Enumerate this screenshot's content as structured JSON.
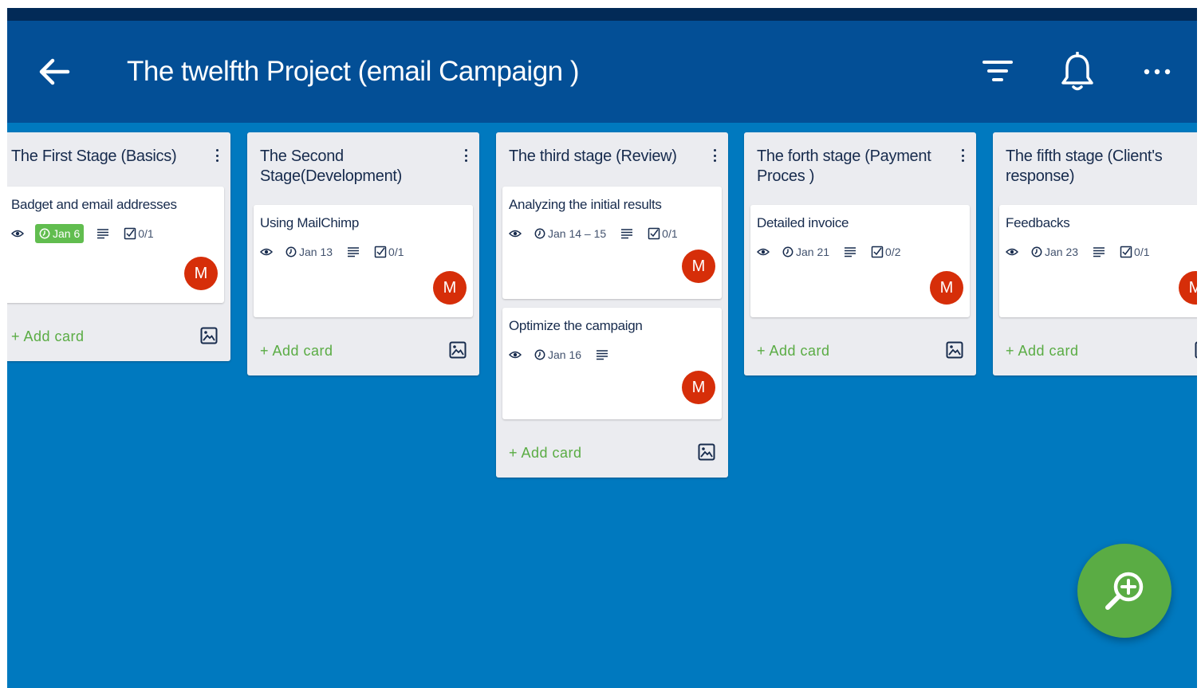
{
  "header": {
    "title": "The twelfth Project (email Campaign )",
    "icons": [
      "back-arrow-icon",
      "filter-icon",
      "bell-icon",
      "more-horizontal-icon"
    ]
  },
  "colors": {
    "statusbar": "#022a57",
    "topbar": "#034f96",
    "board": "#0079bf",
    "list": "#ebecf0",
    "add_card": "#5aac44",
    "avatar": "#d62e09",
    "due_done": "#61bd4f",
    "fab": "#5aac44"
  },
  "lists": [
    {
      "title": "The First Stage (Basics)",
      "add_label": "+ Add card",
      "cards": [
        {
          "title": "Badget and email addresses",
          "due": "Jan 6",
          "due_complete": true,
          "checklist": "0/1",
          "member": "M"
        }
      ]
    },
    {
      "title": "The Second Stage(Development)",
      "add_label": "+ Add card",
      "cards": [
        {
          "title": "Using MailChimp",
          "due": "Jan 13",
          "due_complete": false,
          "checklist": "0/1",
          "member": "M"
        }
      ]
    },
    {
      "title": "The third stage (Review)",
      "add_label": "+ Add card",
      "cards": [
        {
          "title": "Analyzing the initial results",
          "due": "Jan 14 – 15",
          "due_complete": false,
          "checklist": "0/1",
          "member": "M"
        },
        {
          "title": "Optimize the campaign",
          "due": "Jan 16",
          "due_complete": false,
          "checklist": "",
          "member": "M"
        }
      ]
    },
    {
      "title": "The forth stage (Payment Proces )",
      "add_label": "+ Add card",
      "cards": [
        {
          "title": "Detailed invoice",
          "due": "Jan 21",
          "due_complete": false,
          "checklist": "0/2",
          "member": "M"
        }
      ]
    },
    {
      "title": "The fifth stage (Client's response)",
      "add_label": "+ Add card",
      "cards": [
        {
          "title": "Feedbacks",
          "due": "Jan 23",
          "due_complete": false,
          "checklist": "0/1",
          "member": "M"
        }
      ]
    }
  ],
  "fab": {
    "icon": "zoom-in-icon"
  }
}
